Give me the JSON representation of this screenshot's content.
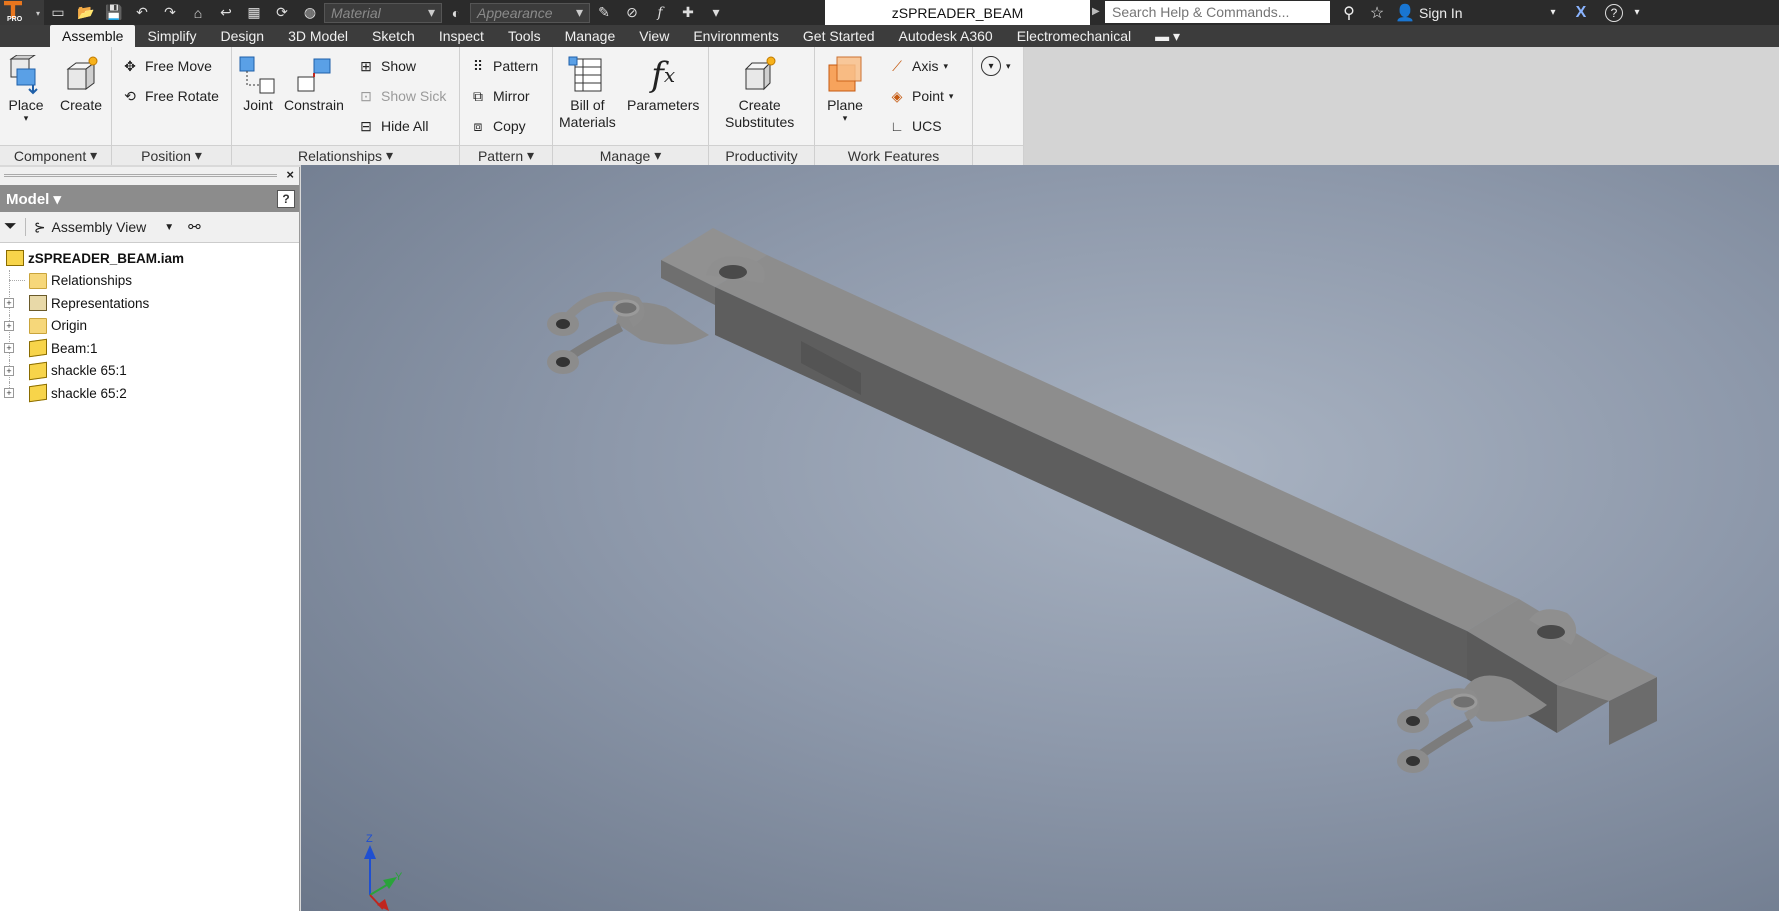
{
  "titlebar": {
    "app_badge": "PRO",
    "material_placeholder": "Material",
    "appearance_placeholder": "Appearance",
    "doc_title": "zSPREADER_BEAM",
    "search_placeholder": "Search Help & Commands...",
    "sign_in": "Sign In",
    "help_icon": "?"
  },
  "tabs": [
    {
      "label": "Assemble",
      "active": true
    },
    {
      "label": "Simplify"
    },
    {
      "label": "Design"
    },
    {
      "label": "3D Model"
    },
    {
      "label": "Sketch"
    },
    {
      "label": "Inspect"
    },
    {
      "label": "Tools"
    },
    {
      "label": "Manage"
    },
    {
      "label": "View"
    },
    {
      "label": "Environments"
    },
    {
      "label": "Get Started"
    },
    {
      "label": "Autodesk A360"
    },
    {
      "label": "Electromechanical"
    }
  ],
  "ribbon": {
    "component": {
      "title": "Component",
      "place": "Place",
      "create": "Create"
    },
    "position": {
      "title": "Position",
      "free_move": "Free Move",
      "free_rotate": "Free Rotate"
    },
    "relationships": {
      "title": "Relationships",
      "joint": "Joint",
      "constrain": "Constrain",
      "show": "Show",
      "show_sick": "Show Sick",
      "hide_all": "Hide All"
    },
    "pattern": {
      "title": "Pattern",
      "pattern": "Pattern",
      "mirror": "Mirror",
      "copy": "Copy"
    },
    "manage": {
      "title": "Manage",
      "bom_line1": "Bill of",
      "bom_line2": "Materials",
      "parameters": "Parameters"
    },
    "productivity": {
      "title": "Productivity",
      "line1": "Create",
      "line2": "Substitutes"
    },
    "work_features": {
      "title": "Work Features",
      "plane": "Plane",
      "axis": "Axis",
      "point": "Point",
      "ucs": "UCS"
    }
  },
  "browser": {
    "title": "Model",
    "view_label": "Assembly View",
    "help": "?",
    "root": "zSPREADER_BEAM.iam",
    "items": [
      {
        "label": "Relationships",
        "type": "folder",
        "expandable": false
      },
      {
        "label": "Representations",
        "type": "rep",
        "expandable": true
      },
      {
        "label": "Origin",
        "type": "folder",
        "expandable": true
      },
      {
        "label": "Beam:1",
        "type": "part",
        "expandable": true
      },
      {
        "label": "shackle 65:1",
        "type": "part",
        "expandable": true
      },
      {
        "label": "shackle 65:2",
        "type": "part",
        "expandable": true
      }
    ]
  },
  "viewport": {
    "triad_z": "Z",
    "triad_y": "Y",
    "colors": {
      "beam_top": "#8d8d8d",
      "beam_front": "#5e5e5e",
      "beam_side": "#777777",
      "axis_z": "#1f4fd1",
      "axis_y": "#2aa33a",
      "axis_x": "#c0261e"
    }
  }
}
